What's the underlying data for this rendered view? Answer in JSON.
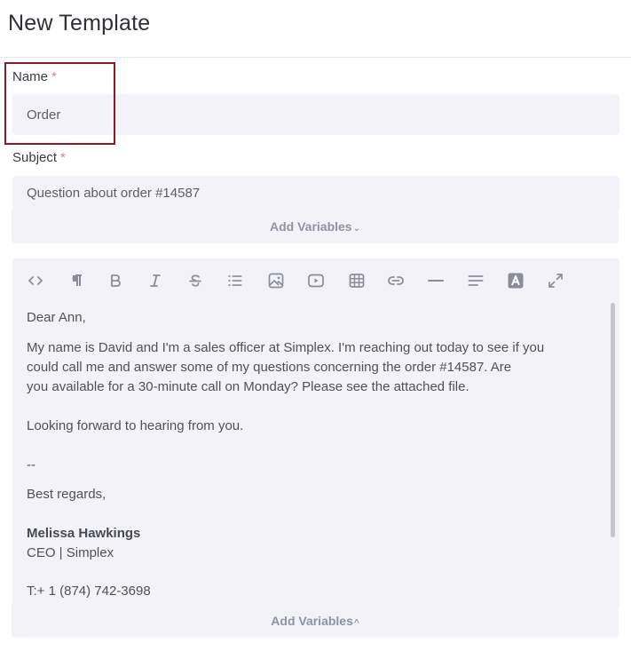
{
  "page": {
    "title": "New Template"
  },
  "form": {
    "name": {
      "label": "Name",
      "required_mark": "*",
      "value": "Order"
    },
    "subject": {
      "label": "Subject",
      "required_mark": "*",
      "value": "Question about order #14587"
    },
    "subject_add_variables": {
      "label": "Add Variables",
      "chevron": "⌄"
    },
    "body_add_variables": {
      "label": "Add Variables",
      "chevron": "^"
    }
  },
  "toolbar": {
    "buttons": [
      {
        "name": "code-view",
        "icon": "code-icon"
      },
      {
        "name": "paragraph",
        "icon": "paragraph-icon"
      },
      {
        "name": "bold",
        "icon": "bold-icon",
        "glyph": "B"
      },
      {
        "name": "italic",
        "icon": "italic-icon",
        "glyph": "I"
      },
      {
        "name": "strikethrough",
        "icon": "strikethrough-icon",
        "glyph": "S"
      },
      {
        "name": "bullet-list",
        "icon": "list-icon"
      },
      {
        "name": "image",
        "icon": "image-icon"
      },
      {
        "name": "video",
        "icon": "video-icon"
      },
      {
        "name": "table",
        "icon": "table-icon"
      },
      {
        "name": "link",
        "icon": "link-icon"
      },
      {
        "name": "horizontal-line",
        "icon": "horizontal-line-icon"
      },
      {
        "name": "align",
        "icon": "align-icon"
      },
      {
        "name": "text-color",
        "icon": "text-color-icon",
        "glyph": "A"
      },
      {
        "name": "fullscreen",
        "icon": "expand-icon"
      }
    ]
  },
  "body": {
    "greeting": "Dear Ann,",
    "paragraph_lines": [
      "My name is David and I'm a sales officer at Simplex. I'm reaching out today to see if you",
      "could call me and answer some of my questions concerning the order #14587. Are",
      "you available for a 30-minute call on Monday? Please see the attached file."
    ],
    "closing_line": "Looking forward to hearing from you.",
    "separator": "--",
    "sign_off": "Best regards,",
    "signature_name": "Melissa Hawkings",
    "signature_title": "CEO | Simplex",
    "phone": "T:+ 1 (874) 742-3698"
  },
  "colors": {
    "highlight": "#8b1a24",
    "required": "#e07a88",
    "field_bg": "#f2f2f8",
    "muted_text": "#8e93a1",
    "icon": "#8a8d99"
  }
}
